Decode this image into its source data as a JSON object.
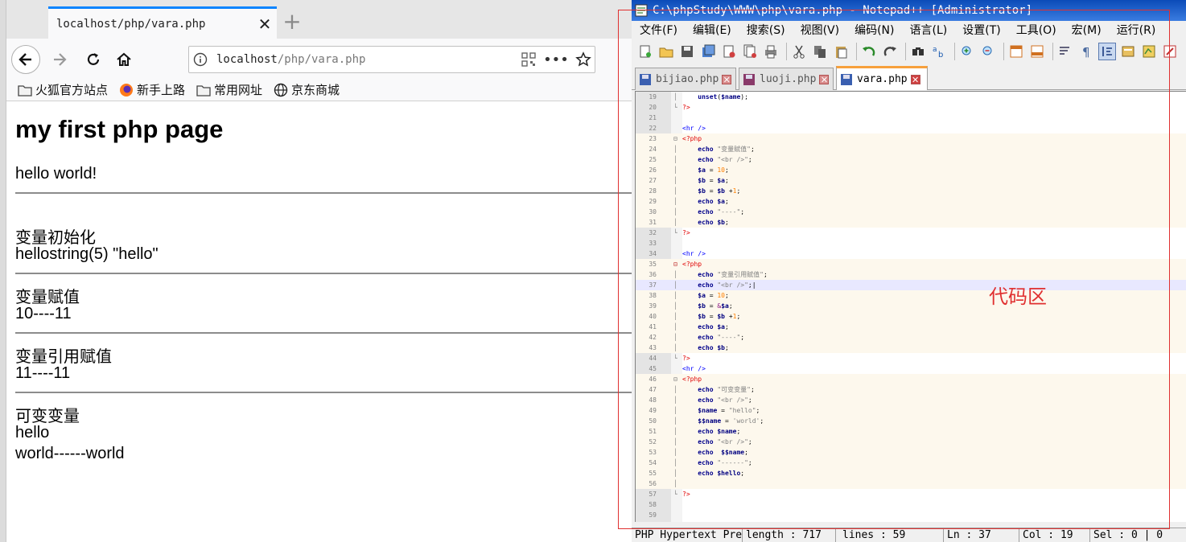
{
  "browser": {
    "tab_title": "localhost/php/vara.php",
    "url_host": "localhost",
    "url_path": "/php/vara.php",
    "bookmarks": [
      "火狐官方站点",
      "新手上路",
      "常用网址",
      "京东商城"
    ],
    "page": {
      "heading": "my first php page",
      "line1": "hello world!",
      "sec1_title": "变量初始化",
      "sec1_value": "hellostring(5) \"hello\"",
      "sec2_title": "变量赋值",
      "sec2_value": "10----11",
      "sec3_title": "变量引用赋值",
      "sec3_value": "11----11",
      "sec4_title": "可变变量",
      "sec4_value1": "hello",
      "sec4_value2": "world------world"
    }
  },
  "npp": {
    "title": "C:\\phpStudy\\WWW\\php\\vara.php - Notepad++ [Administrator]",
    "menu": [
      "文件(F)",
      "编辑(E)",
      "搜索(S)",
      "视图(V)",
      "编码(N)",
      "语言(L)",
      "设置(T)",
      "工具(O)",
      "宏(M)",
      "运行(R)"
    ],
    "tabs": [
      "bijiao.php",
      "luoji.php",
      "vara.php"
    ],
    "status": {
      "lang": "PHP Hypertext Preprocessor file",
      "length": "length : 717",
      "lines": "lines : 59",
      "ln": "Ln : 37",
      "col": "Col : 19",
      "sel": "Sel : 0 | 0"
    },
    "annotation": "代码区"
  }
}
